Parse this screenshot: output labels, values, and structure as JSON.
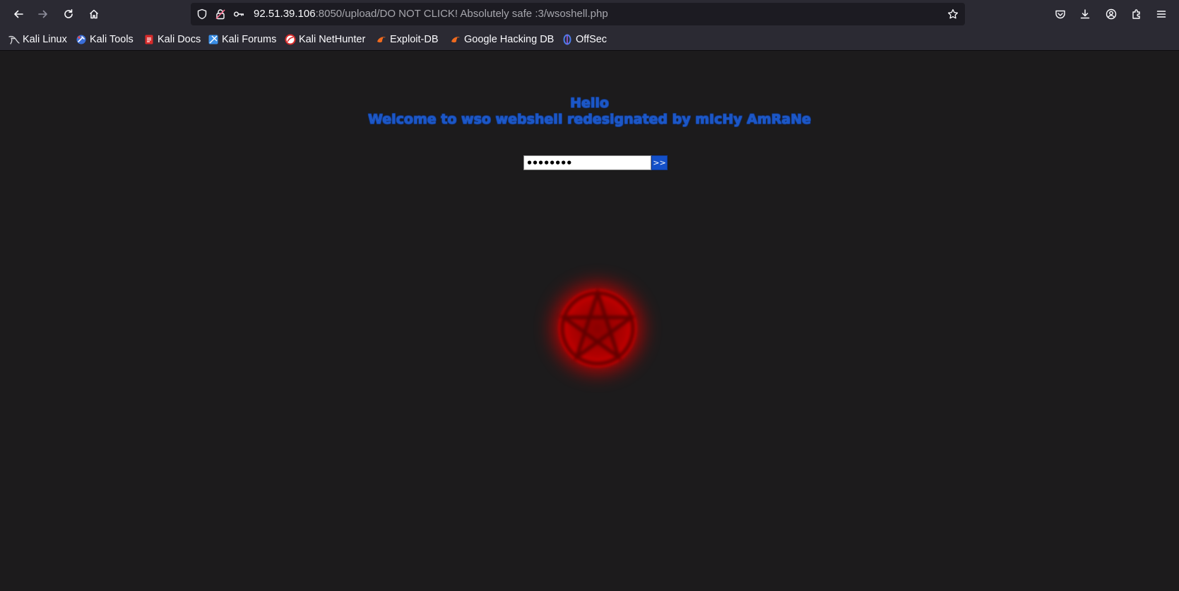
{
  "browser": {
    "url": {
      "host": "92.51.39.106",
      "rest": ":8050/upload/DO NOT CLICK! Absolutely safe :3/wsoshell.php"
    },
    "bookmarks": [
      {
        "label": "Kali Linux",
        "icon": "kali-dragon-icon"
      },
      {
        "label": "Kali Tools",
        "icon": "kali-tools-icon"
      },
      {
        "label": "Kali Docs",
        "icon": "kali-docs-icon"
      },
      {
        "label": "Kali Forums",
        "icon": "kali-forums-icon"
      },
      {
        "label": "Kali NetHunter",
        "icon": "kali-nethunter-icon"
      },
      {
        "label": "Exploit-DB",
        "icon": "exploit-db-icon"
      },
      {
        "label": "Google Hacking DB",
        "icon": "google-hacking-db-icon"
      },
      {
        "label": "OffSec",
        "icon": "offsec-icon"
      }
    ]
  },
  "page": {
    "greeting": "Hello",
    "welcome": "Welcome to wso webshell redesignated by mIcHy AmRaNe",
    "password_value": "••••••••",
    "submit_label": ">>",
    "heading_color": "#1a56c8",
    "emblem_color": "#c00000"
  }
}
